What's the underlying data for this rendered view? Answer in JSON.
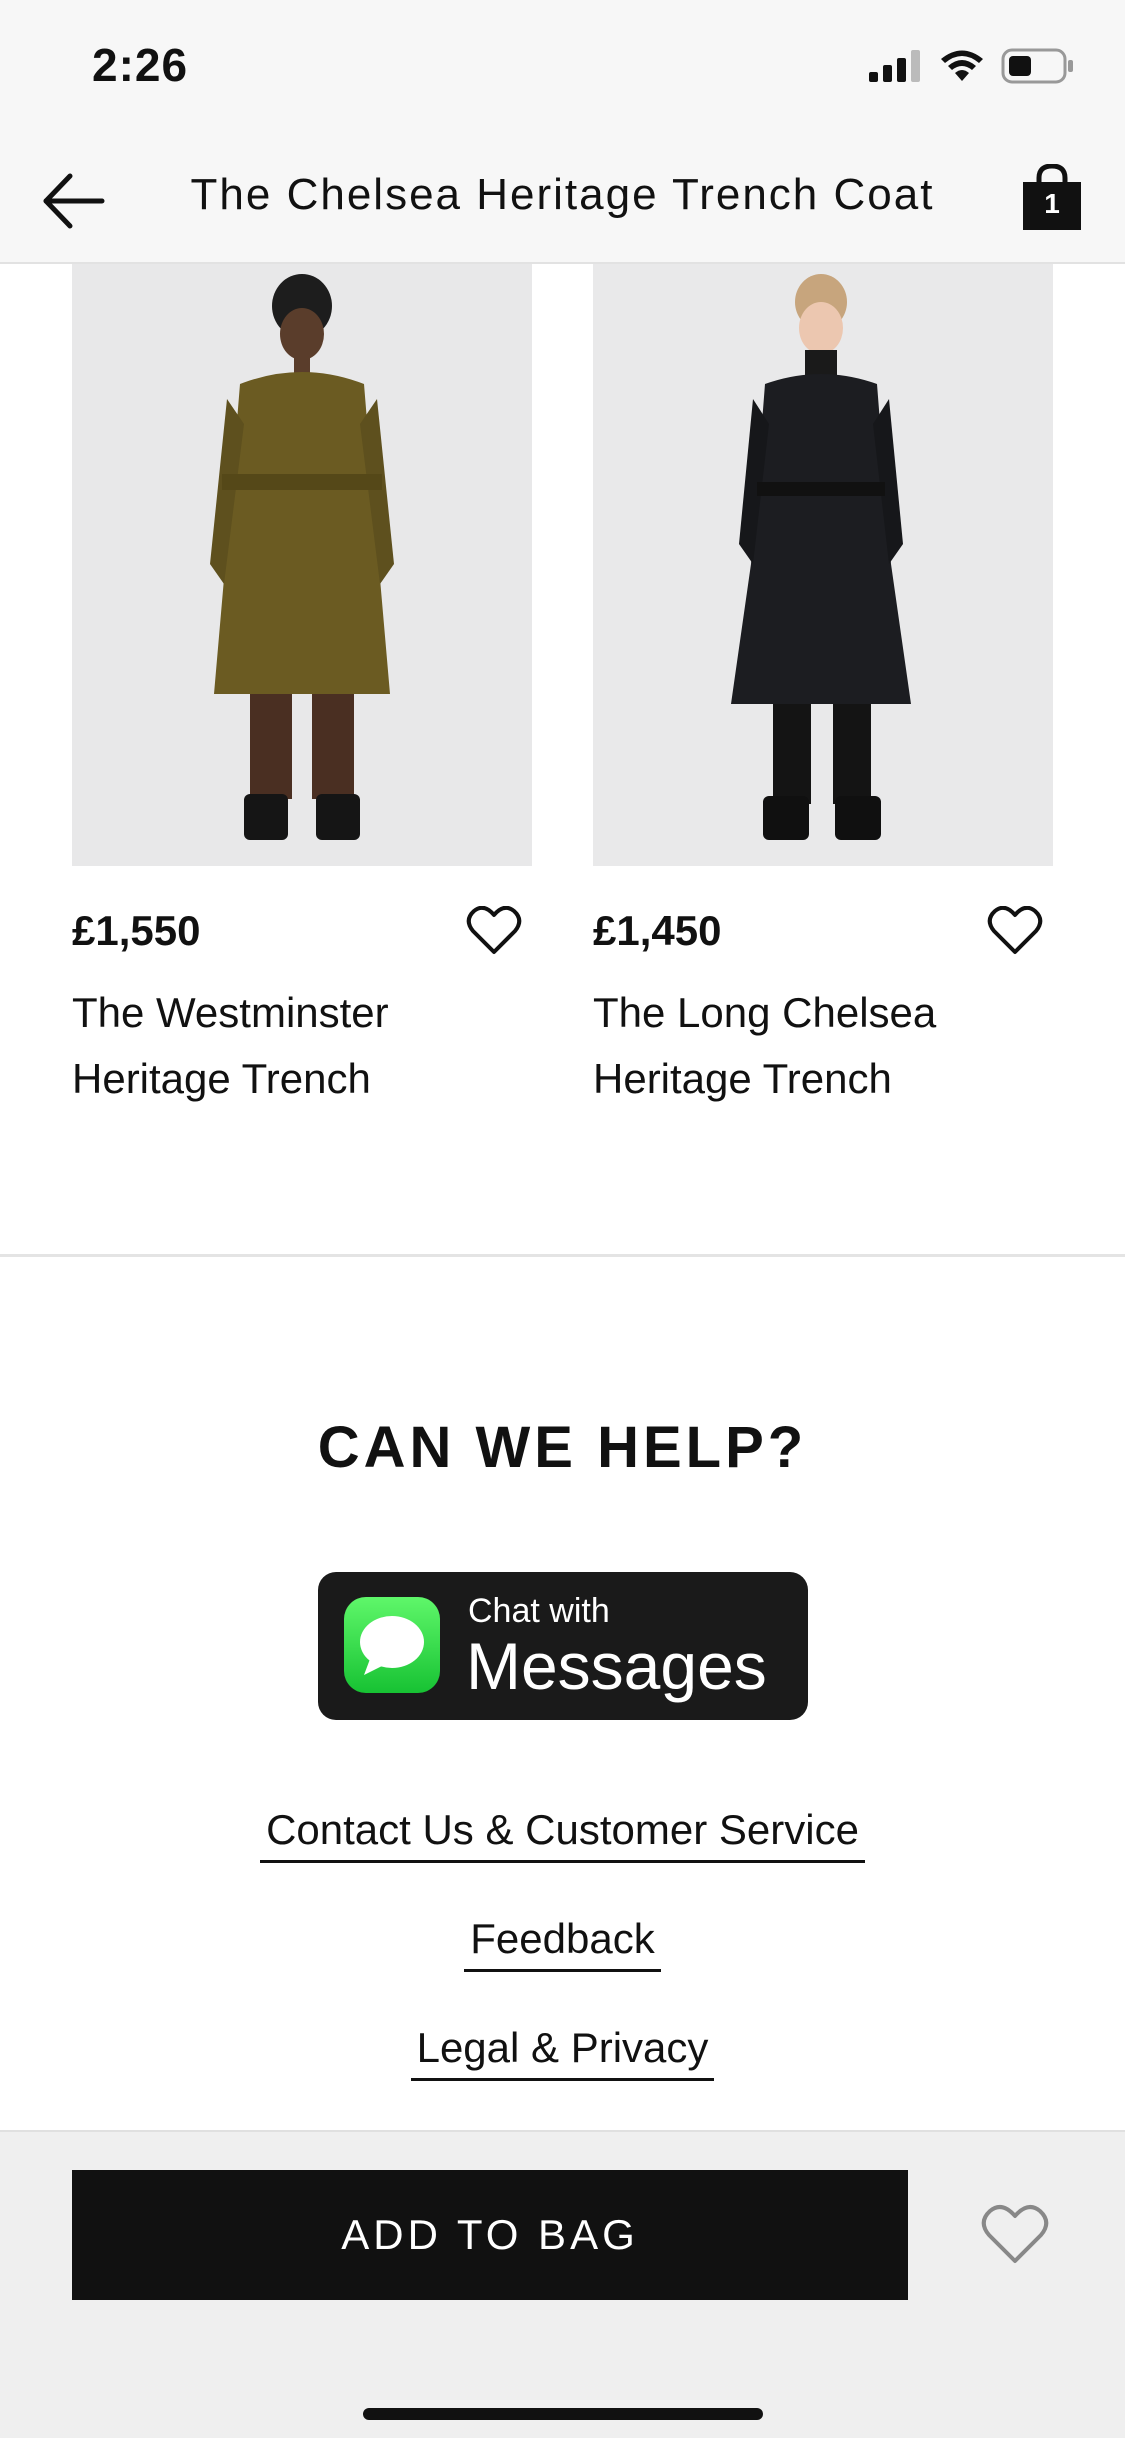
{
  "status_bar": {
    "time": "2:26"
  },
  "nav": {
    "title": "The Chelsea Heritage Trench Coat",
    "bag_count": "1"
  },
  "products": [
    {
      "price": "£1,550",
      "name_line1": "The Westminster",
      "name_line2": "Heritage Trench",
      "coat_color": "#6b5b22"
    },
    {
      "price": "£1,450",
      "name_line1": "The Long Chelsea",
      "name_line2": "Heritage Trench",
      "coat_color": "#1c1d21"
    }
  ],
  "help": {
    "title": "CAN WE HELP?",
    "messages_small": "Chat with",
    "messages_big": "Messages",
    "links": [
      "Contact Us & Customer Service",
      "Feedback",
      "Legal & Privacy"
    ]
  },
  "footer": {
    "add_to_bag": "ADD TO BAG"
  },
  "colors": {
    "accent": "#111111",
    "messages_green": "#2bd84a",
    "background": "#ffffff"
  }
}
